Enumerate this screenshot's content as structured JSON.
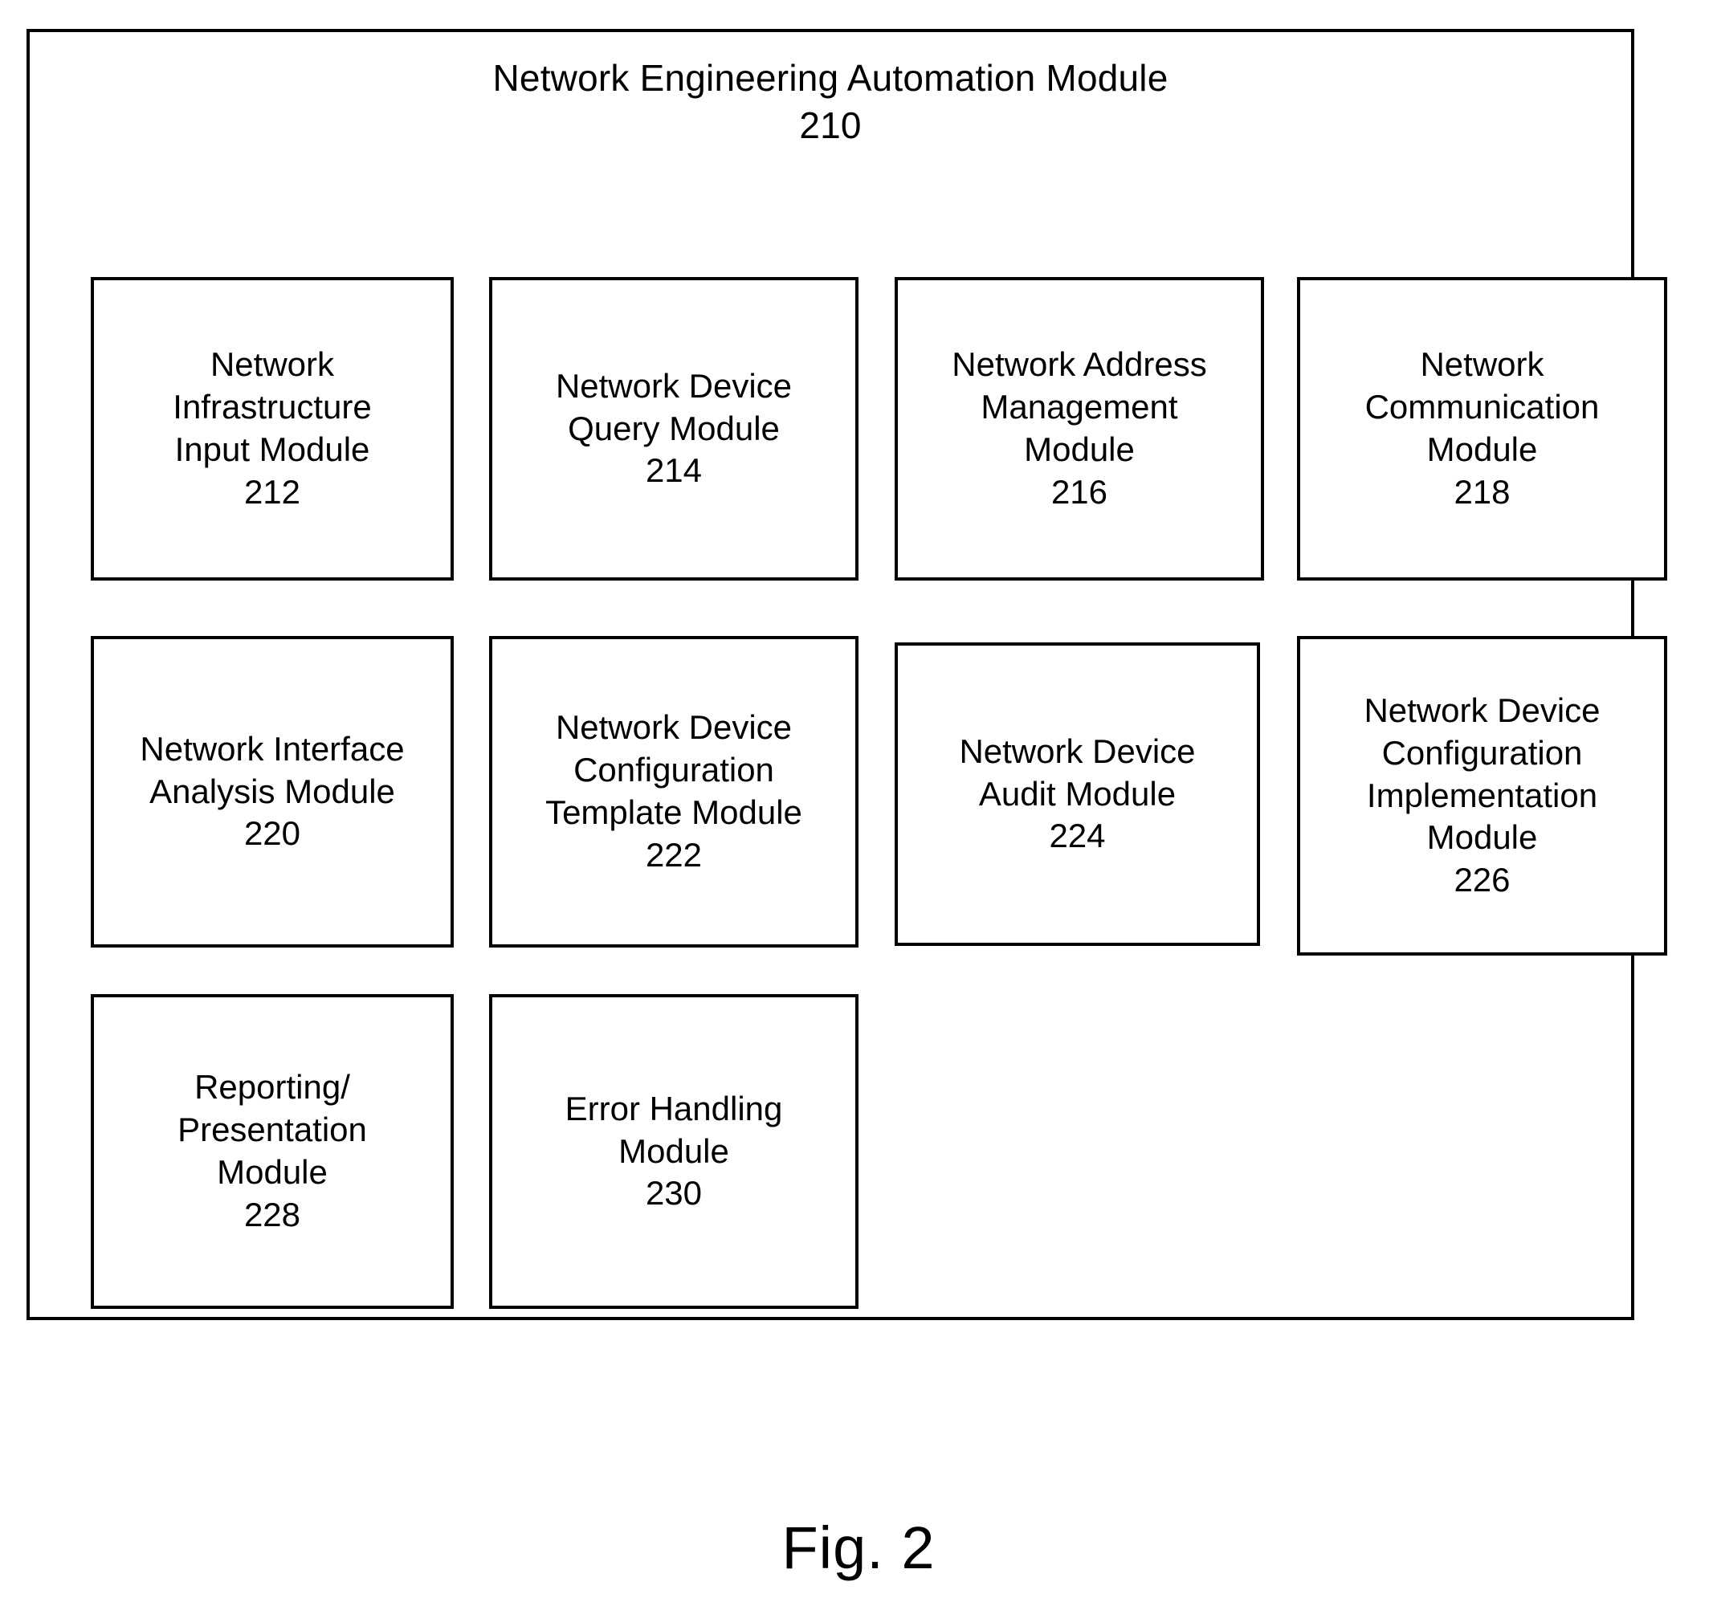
{
  "figure": {
    "caption": "Fig. 2",
    "outer_module": {
      "title": "Network Engineering Automation Module",
      "reference_numeral": "210"
    },
    "modules": [
      {
        "id": "212",
        "label": "Network\nInfrastructure\nInput Module\n212",
        "name": "Network Infrastructure Input Module",
        "numeral": "212",
        "row": 1,
        "column": 1
      },
      {
        "id": "214",
        "label": "Network Device\nQuery Module\n214",
        "name": "Network Device Query Module",
        "numeral": "214",
        "row": 1,
        "column": 2
      },
      {
        "id": "216",
        "label": "Network Address\nManagement\nModule\n216",
        "name": "Network Address Management Module",
        "numeral": "216",
        "row": 1,
        "column": 3
      },
      {
        "id": "218",
        "label": "Network\nCommunication\nModule\n218",
        "name": "Network Communication Module",
        "numeral": "218",
        "row": 1,
        "column": 4
      },
      {
        "id": "220",
        "label": "Network Interface\nAnalysis  Module\n220",
        "name": "Network Interface Analysis  Module",
        "numeral": "220",
        "row": 2,
        "column": 1
      },
      {
        "id": "222",
        "label": "Network Device\nConfiguration\nTemplate Module\n222",
        "name": "Network Device Configuration Template Module",
        "numeral": "222",
        "row": 2,
        "column": 2
      },
      {
        "id": "224",
        "label": "Network Device\nAudit Module\n224",
        "name": "Network Device Audit Module",
        "numeral": "224",
        "row": 2,
        "column": 3
      },
      {
        "id": "226",
        "label": "Network Device\nConfiguration\nImplementation\nModule\n226",
        "name": "Network Device Configuration Implementation Module",
        "numeral": "226",
        "row": 2,
        "column": 4
      },
      {
        "id": "228",
        "label": "Reporting/\nPresentation\nModule\n228",
        "name": "Reporting/Presentation Module",
        "numeral": "228",
        "row": 3,
        "column": 1
      },
      {
        "id": "230",
        "label": "Error Handling\nModule\n230",
        "name": "Error Handling Module",
        "numeral": "230",
        "row": 3,
        "column": 2
      }
    ]
  },
  "colors": {
    "stroke": "#000000",
    "background": "#ffffff",
    "text": "#000000"
  }
}
